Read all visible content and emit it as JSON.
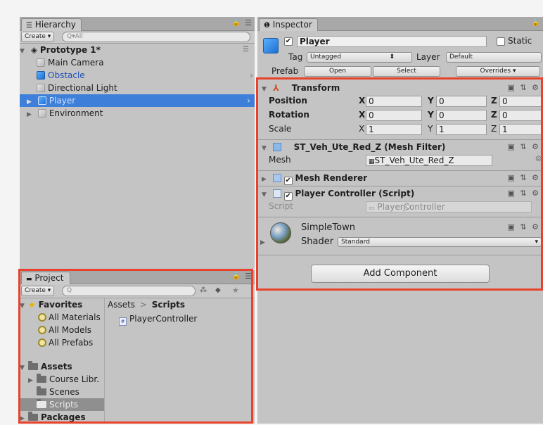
{
  "hierarchy": {
    "tab_label": "Hierarchy",
    "create_label": "Create",
    "search_placeholder": "All",
    "scene_name": "Prototype 1*",
    "items": [
      {
        "label": "Main Camera"
      },
      {
        "label": "Obstacle"
      },
      {
        "label": "Directional Light"
      },
      {
        "label": "Player"
      },
      {
        "label": "Environment"
      }
    ]
  },
  "inspector": {
    "tab_label": "Inspector",
    "object_name": "Player",
    "static_label": "Static",
    "tag_label": "Tag",
    "tag_value": "Untagged",
    "layer_label": "Layer",
    "layer_value": "Default",
    "prefab_label": "Prefab",
    "prefab_open": "Open",
    "prefab_select": "Select",
    "prefab_overrides": "Overrides",
    "transform": {
      "title": "Transform",
      "position_label": "Position",
      "rotation_label": "Rotation",
      "scale_label": "Scale",
      "position": {
        "x": "0",
        "y": "0",
        "z": "0"
      },
      "rotation": {
        "x": "0",
        "y": "0",
        "z": "0"
      },
      "scale": {
        "x": "1",
        "y": "1",
        "z": "1"
      },
      "x_label": "X",
      "y_label": "Y",
      "z_label": "Z"
    },
    "mesh_filter": {
      "title": "ST_Veh_Ute_Red_Z (Mesh Filter)",
      "mesh_label": "Mesh",
      "mesh_value": "ST_Veh_Ute_Red_Z"
    },
    "mesh_renderer": {
      "title": "Mesh Renderer"
    },
    "player_controller": {
      "title": "Player Controller (Script)",
      "script_label": "Script",
      "script_value": "PlayerController"
    },
    "material": {
      "name": "SimpleTown",
      "shader_label": "Shader",
      "shader_value": "Standard"
    },
    "add_component_label": "Add Component"
  },
  "project": {
    "tab_label": "Project",
    "create_label": "Create",
    "favorites_label": "Favorites",
    "favorites": [
      "All Materials",
      "All Models",
      "All Prefabs"
    ],
    "assets_label": "Assets",
    "assets_children": [
      "Course Libr.",
      "Scenes",
      "Scripts"
    ],
    "packages_label": "Packages",
    "breadcrumb_root": "Assets",
    "breadcrumb_sep": ">",
    "breadcrumb_current": "Scripts",
    "files": [
      "PlayerController"
    ]
  },
  "colors": {
    "highlight": "#3d7fd9",
    "annotation": "#e8422c"
  }
}
